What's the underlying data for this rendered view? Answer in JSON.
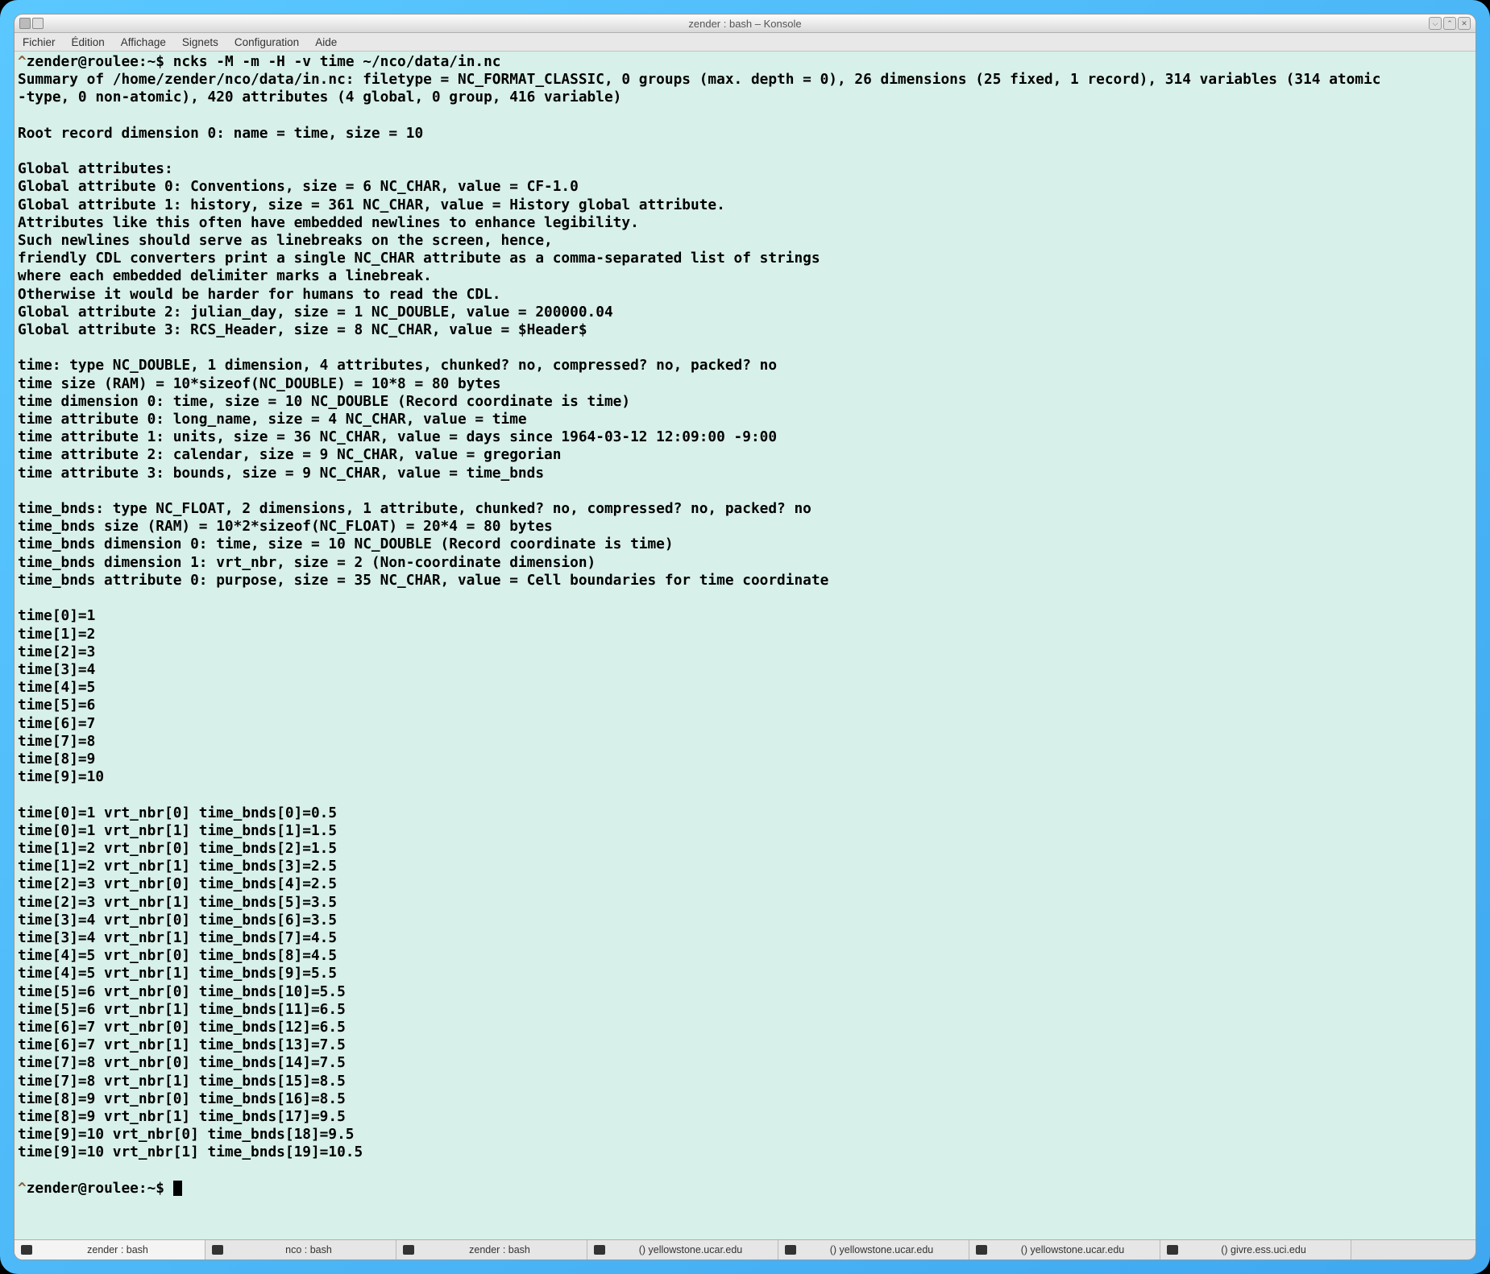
{
  "window": {
    "title": "zender : bash – Konsole"
  },
  "menu": {
    "items": [
      "Fichier",
      "Édition",
      "Affichage",
      "Signets",
      "Configuration",
      "Aide"
    ]
  },
  "window_controls": {
    "minimize": "⌵",
    "maximize": "⌃",
    "close": "✕"
  },
  "tabs": {
    "items": [
      {
        "label": "zender : bash",
        "active": true
      },
      {
        "label": "nco : bash",
        "active": false
      },
      {
        "label": "zender : bash",
        "active": false
      },
      {
        "label": "() yellowstone.ucar.edu",
        "active": false
      },
      {
        "label": "() yellowstone.ucar.edu",
        "active": false
      },
      {
        "label": "() yellowstone.ucar.edu",
        "active": false
      },
      {
        "label": "() givre.ess.uci.edu",
        "active": false
      }
    ]
  },
  "terminal": {
    "prompt1_caret": "^",
    "prompt1": "zender@roulee:~$ ",
    "command": "ncks -M -m -H -v time ~/nco/data/in.nc",
    "body": "Summary of /home/zender/nco/data/in.nc: filetype = NC_FORMAT_CLASSIC, 0 groups (max. depth = 0), 26 dimensions (25 fixed, 1 record), 314 variables (314 atomic\n-type, 0 non-atomic), 420 attributes (4 global, 0 group, 416 variable)\n\nRoot record dimension 0: name = time, size = 10\n\nGlobal attributes:\nGlobal attribute 0: Conventions, size = 6 NC_CHAR, value = CF-1.0\nGlobal attribute 1: history, size = 361 NC_CHAR, value = History global attribute.\nAttributes like this often have embedded newlines to enhance legibility.\nSuch newlines should serve as linebreaks on the screen, hence,\nfriendly CDL converters print a single NC_CHAR attribute as a comma-separated list of strings\nwhere each embedded delimiter marks a linebreak.\nOtherwise it would be harder for humans to read the CDL.\nGlobal attribute 2: julian_day, size = 1 NC_DOUBLE, value = 200000.04\nGlobal attribute 3: RCS_Header, size = 8 NC_CHAR, value = $Header$\n\ntime: type NC_DOUBLE, 1 dimension, 4 attributes, chunked? no, compressed? no, packed? no\ntime size (RAM) = 10*sizeof(NC_DOUBLE) = 10*8 = 80 bytes\ntime dimension 0: time, size = 10 NC_DOUBLE (Record coordinate is time)\ntime attribute 0: long_name, size = 4 NC_CHAR, value = time\ntime attribute 1: units, size = 36 NC_CHAR, value = days since 1964-03-12 12:09:00 -9:00\ntime attribute 2: calendar, size = 9 NC_CHAR, value = gregorian\ntime attribute 3: bounds, size = 9 NC_CHAR, value = time_bnds\n\ntime_bnds: type NC_FLOAT, 2 dimensions, 1 attribute, chunked? no, compressed? no, packed? no\ntime_bnds size (RAM) = 10*2*sizeof(NC_FLOAT) = 20*4 = 80 bytes\ntime_bnds dimension 0: time, size = 10 NC_DOUBLE (Record coordinate is time)\ntime_bnds dimension 1: vrt_nbr, size = 2 (Non-coordinate dimension)\ntime_bnds attribute 0: purpose, size = 35 NC_CHAR, value = Cell boundaries for time coordinate\n\ntime[0]=1\ntime[1]=2\ntime[2]=3\ntime[3]=4\ntime[4]=5\ntime[5]=6\ntime[6]=7\ntime[7]=8\ntime[8]=9\ntime[9]=10\n\ntime[0]=1 vrt_nbr[0] time_bnds[0]=0.5\ntime[0]=1 vrt_nbr[1] time_bnds[1]=1.5\ntime[1]=2 vrt_nbr[0] time_bnds[2]=1.5\ntime[1]=2 vrt_nbr[1] time_bnds[3]=2.5\ntime[2]=3 vrt_nbr[0] time_bnds[4]=2.5\ntime[2]=3 vrt_nbr[1] time_bnds[5]=3.5\ntime[3]=4 vrt_nbr[0] time_bnds[6]=3.5\ntime[3]=4 vrt_nbr[1] time_bnds[7]=4.5\ntime[4]=5 vrt_nbr[0] time_bnds[8]=4.5\ntime[4]=5 vrt_nbr[1] time_bnds[9]=5.5\ntime[5]=6 vrt_nbr[0] time_bnds[10]=5.5\ntime[5]=6 vrt_nbr[1] time_bnds[11]=6.5\ntime[6]=7 vrt_nbr[0] time_bnds[12]=6.5\ntime[6]=7 vrt_nbr[1] time_bnds[13]=7.5\ntime[7]=8 vrt_nbr[0] time_bnds[14]=7.5\ntime[7]=8 vrt_nbr[1] time_bnds[15]=8.5\ntime[8]=9 vrt_nbr[0] time_bnds[16]=8.5\ntime[8]=9 vrt_nbr[1] time_bnds[17]=9.5\ntime[9]=10 vrt_nbr[0] time_bnds[18]=9.5\ntime[9]=10 vrt_nbr[1] time_bnds[19]=10.5",
    "prompt2_caret": "^",
    "prompt2": "zender@roulee:~$ "
  }
}
